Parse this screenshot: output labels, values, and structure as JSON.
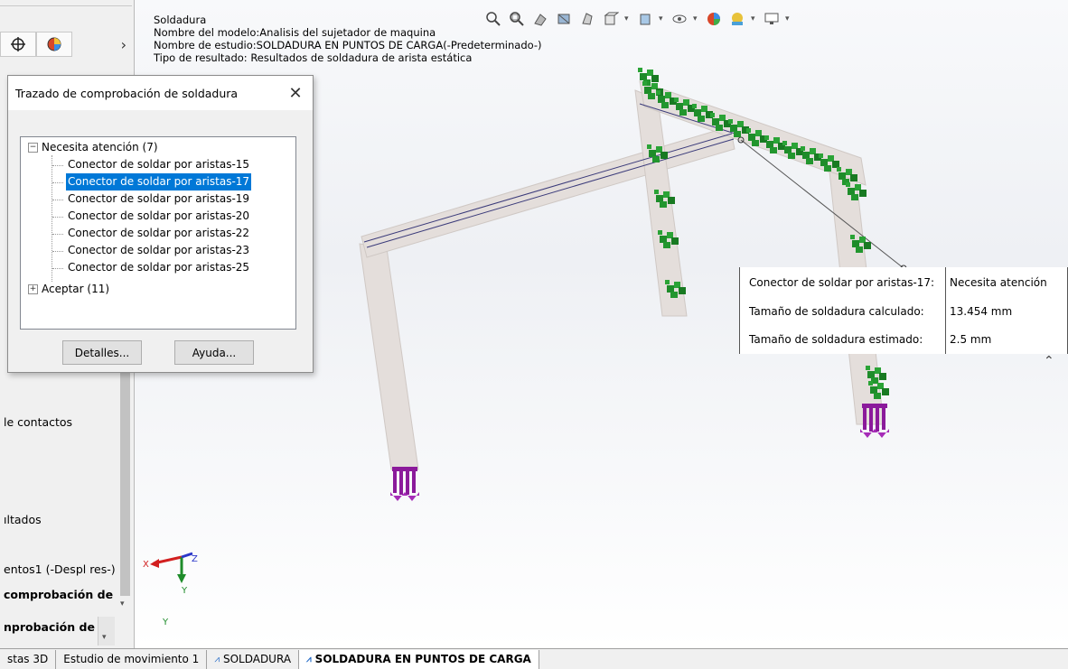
{
  "header": {
    "line1": "Soldadura",
    "line2": "Nombre del modelo:Analisis del sujetador de maquina",
    "line3": "Nombre de estudio:SOLDADURA EN PUNTOS DE CARGA(-Predeterminado-)",
    "line4": "Tipo de resultado: Resultados de soldadura de arista estática"
  },
  "toolbar": {
    "icons": [
      "zoom-to-fit-icon",
      "zoom-to-area-icon",
      "previous-view-icon",
      "section-view-icon",
      "view-settings-icon",
      "view-orientation-icon",
      "display-style-icon",
      "hide-show-icon",
      "edit-appearance-icon",
      "scene-icon",
      "display-manager-icon"
    ]
  },
  "left_panel": {
    "texts": {
      "contacts": "le contactos",
      "results": "ıltados",
      "item_desp": "entos1 (-Despl res-)",
      "item_comp1": "comprobación de",
      "item_comp2": "nprobación de"
    }
  },
  "dialog": {
    "title": "Trazado de comprobación de soldadura",
    "tree": {
      "group1": "Necesita atención (7)",
      "children": [
        "Conector de soldar por aristas-15",
        "Conector de soldar por aristas-17",
        "Conector de soldar por aristas-19",
        "Conector de soldar por aristas-20",
        "Conector de soldar por aristas-22",
        "Conector de soldar por aristas-23",
        "Conector de soldar por aristas-25"
      ],
      "selected_index": 1,
      "group2": "Aceptar (11)"
    },
    "details_label": "Detalles...",
    "help_label": "Ayuda..."
  },
  "result_box": {
    "rows": [
      {
        "label": "Conector de soldar por aristas-17:",
        "value": "Necesita atención"
      },
      {
        "label": "Tamaño de soldadura calculado:",
        "value": "13.454 mm"
      },
      {
        "label": "Tamaño de soldadura estimado:",
        "value": "2.5 mm"
      }
    ]
  },
  "triad": {
    "x": "X",
    "y": "Y",
    "z": "Z",
    "y2": "Y"
  },
  "bottom_tabs": {
    "tab1": "stas 3D",
    "tab2": "Estudio de movimiento 1",
    "tab3": "SOLDADURA",
    "tab4": "SOLDADURA EN PUNTOS DE CARGA"
  },
  "colors": {
    "selection": "#0078d7",
    "load_arrows": "#1e8c2a",
    "fixture": "#8b1a9b",
    "beam": "#e4dedb"
  }
}
